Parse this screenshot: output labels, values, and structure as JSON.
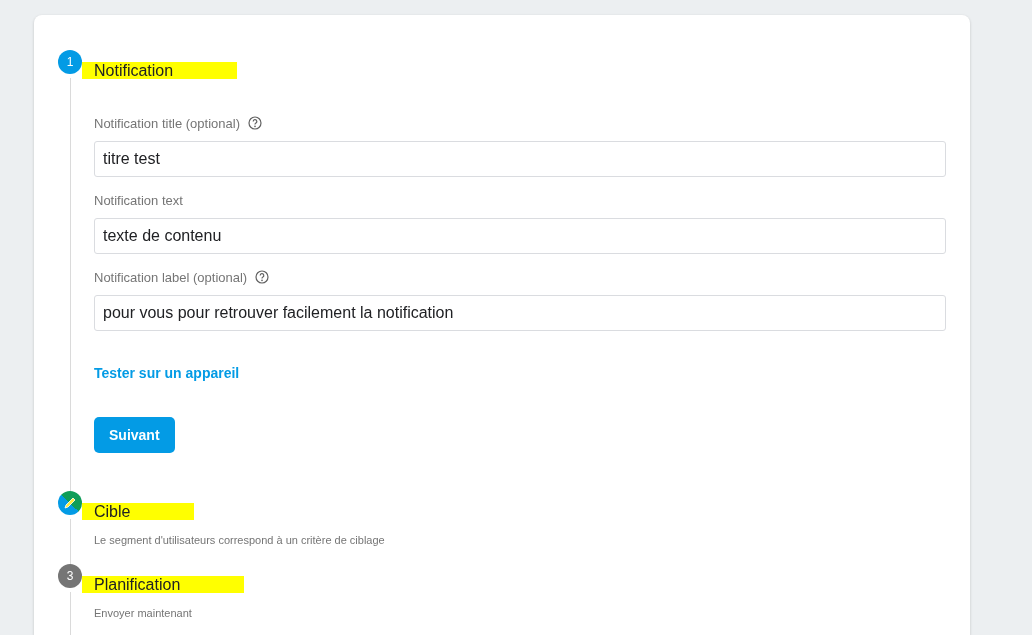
{
  "steps": [
    {
      "kind": "active",
      "number": "1",
      "title": "Notification",
      "highlighted": true,
      "fields": [
        {
          "label": "Notification title (optional)",
          "help": true,
          "value": "titre test"
        },
        {
          "label": "Notification text",
          "help": false,
          "value": "texte de contenu"
        },
        {
          "label": "Notification label (optional)",
          "help": true,
          "value": "pour vous pour retrouver facilement la notification"
        }
      ],
      "link": "Tester sur un appareil",
      "button": "Suivant"
    },
    {
      "kind": "edited",
      "title": "Cible",
      "highlighted": true,
      "subtitle": "Le segment d'utilisateurs correspond à un critère de ciblage"
    },
    {
      "kind": "pending",
      "number": "3",
      "title": "Planification",
      "highlighted": true,
      "subtitle": "Envoyer maintenant"
    }
  ]
}
